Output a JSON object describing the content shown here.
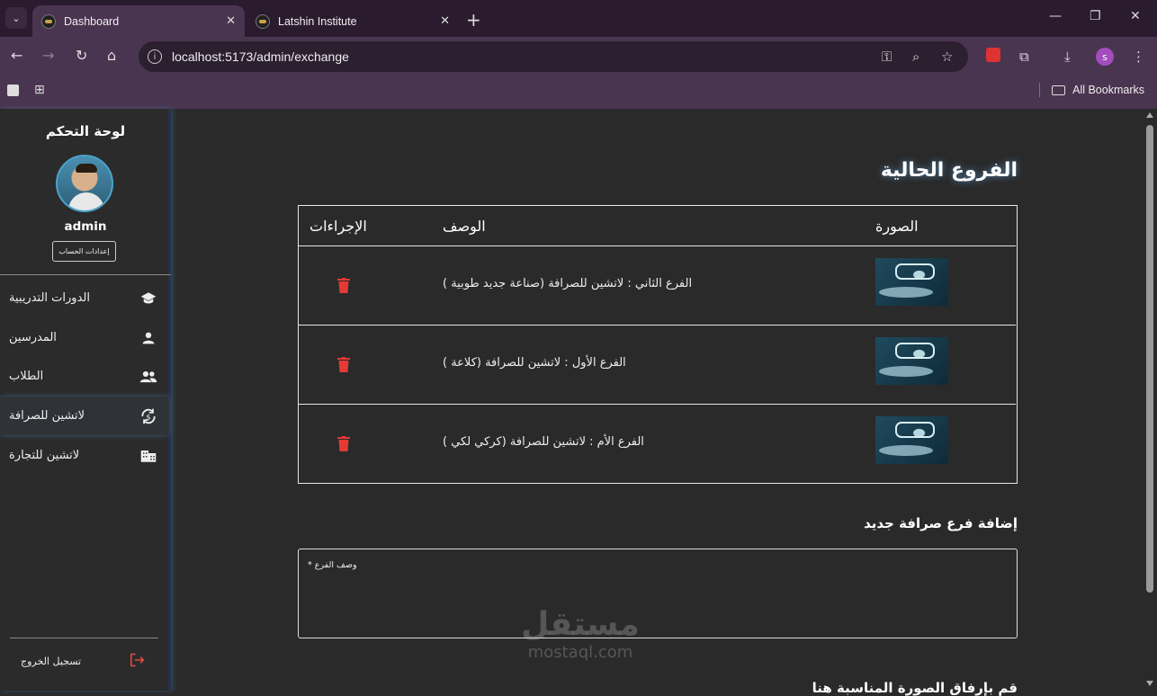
{
  "browser": {
    "tabs": [
      {
        "title": "Dashboard",
        "active": true
      },
      {
        "title": "Latshin Institute",
        "active": false
      }
    ],
    "url": "localhost:5173/admin/exchange",
    "bookmarks_label": "All Bookmarks",
    "profile_initial": "s",
    "colors": {
      "tabbar": "#2a1b2e",
      "toolbar": "#4a3550",
      "profile": "#a34dbf"
    }
  },
  "sidebar": {
    "title": "لوحة التحكم",
    "username": "admin",
    "settings_button": "إعدادات الحساب",
    "items": [
      {
        "label": "الدورات التدريبية",
        "icon": "school-icon"
      },
      {
        "label": "المدرسين",
        "icon": "person-icon"
      },
      {
        "label": "الطلاب",
        "icon": "people-icon"
      },
      {
        "label": "لاتشين للصرافة",
        "icon": "currency-exchange-icon",
        "active": true
      },
      {
        "label": "لاتشين للتجارة",
        "icon": "business-icon"
      }
    ],
    "logout": "تسجيل الخروج",
    "colors": {
      "accent": "#4aa3c8",
      "logout": "#e04a3a"
    }
  },
  "main": {
    "heading": "الفروع الحالية",
    "table": {
      "headers": {
        "image": "الصورة",
        "description": "الوصف",
        "actions": "الإجراءات"
      },
      "rows": [
        {
          "description": "الفرع الثاني : لاتشين للصرافة (صناعة جديد طوبية )"
        },
        {
          "description": "الفرع الأول : لاتشين للصرافة (كلاعة )"
        },
        {
          "description": "الفرع الأم : لاتشين للصرافة (كركي لكي )"
        }
      ],
      "delete_color": "#e53935"
    },
    "add_section_title": "إضافة فرع صرافة جديد",
    "description_field_label": "وصف الفرع *",
    "upload_section_title": "قم بإرفاق الصورة المناسبة هنا"
  },
  "watermark": {
    "big": "مستقل",
    "small": "mostaql.com"
  }
}
